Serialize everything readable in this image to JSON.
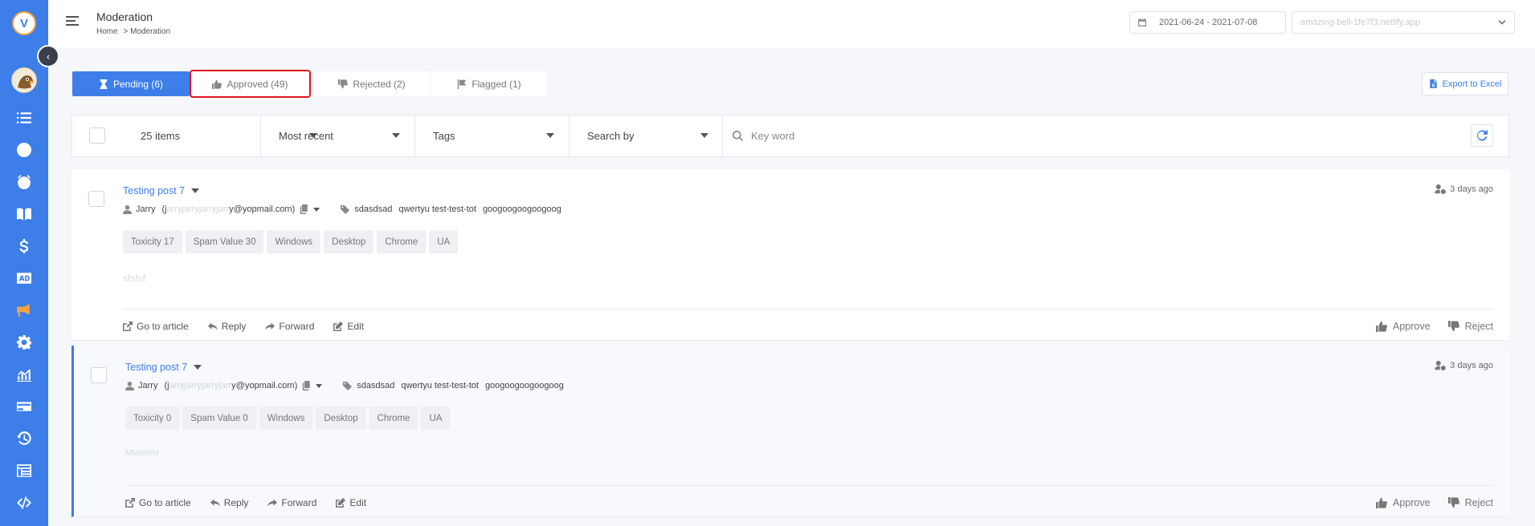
{
  "sidebar": {
    "logo_letter": "V",
    "collapse_icon": "chevron-left-icon",
    "icons": [
      "list-icon",
      "clock-icon",
      "alarm-icon",
      "book-icon",
      "dollar-icon",
      "ad-icon",
      "megaphone-icon",
      "gear-icon",
      "analytics-icon",
      "credit-card-icon",
      "history-icon",
      "table-icon",
      "code-icon"
    ],
    "active_icon": "megaphone-icon",
    "active_color": "#f4a340"
  },
  "header": {
    "title": "Moderation",
    "breadcrumb": [
      "Home",
      "> Moderation"
    ],
    "date_range": "2021-06-24 - 2021-07-08",
    "site": "amazing-bell-1fe7f3.netlify.app"
  },
  "tabs": [
    {
      "label": "Pending (6)",
      "icon": "hourglass-icon",
      "active": true
    },
    {
      "label": "Approved (49)",
      "icon": "thumbs-up-icon",
      "active": false,
      "highlighted": true
    },
    {
      "label": "Rejected (2)",
      "icon": "thumbs-down-icon",
      "active": false
    },
    {
      "label": "Flagged (1)",
      "icon": "flag-icon",
      "active": false
    }
  ],
  "export_label": "Export to Excel",
  "filters": {
    "items": "25 items",
    "sort": "Most recent",
    "tags": "Tags",
    "search_by": "Search by",
    "keyword_placeholder": "Key word"
  },
  "comments": [
    {
      "title": "Testing post 7",
      "time": "3 days ago",
      "author": "Jarry",
      "email_prefix": "(j",
      "email_hidden": "arryjarryjarryjarr",
      "email_suffix": "y@yopmail.com)",
      "tags": [
        "sdasdsad",
        "qwertyu test-test-tot",
        "googoogoogoogoog"
      ],
      "badges": [
        "Toxicity 17",
        "Spam Value 30",
        "Windows",
        "Desktop",
        "Chrome",
        "UA"
      ],
      "body": "sfsfsf",
      "actions": [
        "Go to article",
        "Reply",
        "Forward",
        "Edit"
      ],
      "approve": "Approve",
      "reject": "Reject"
    },
    {
      "title": "Testing post 7",
      "time": "3 days ago",
      "author": "Jarry",
      "email_prefix": "(j",
      "email_hidden": "arryjarryjarryjarr",
      "email_suffix": "y@yopmail.com)",
      "tags": [
        "sdasdsad",
        "qwertyu test-test-tot",
        "googoogoogoogoog"
      ],
      "badges": [
        "Toxicity 0",
        "Spam Value 0",
        "Windows",
        "Desktop",
        "Chrome",
        "UA"
      ],
      "body": "MMMMM",
      "actions": [
        "Go to article",
        "Reply",
        "Forward",
        "Edit"
      ],
      "approve": "Approve",
      "reject": "Reject"
    }
  ],
  "colors": {
    "primary": "#3d7ee8",
    "highlight": "#e0161b"
  }
}
